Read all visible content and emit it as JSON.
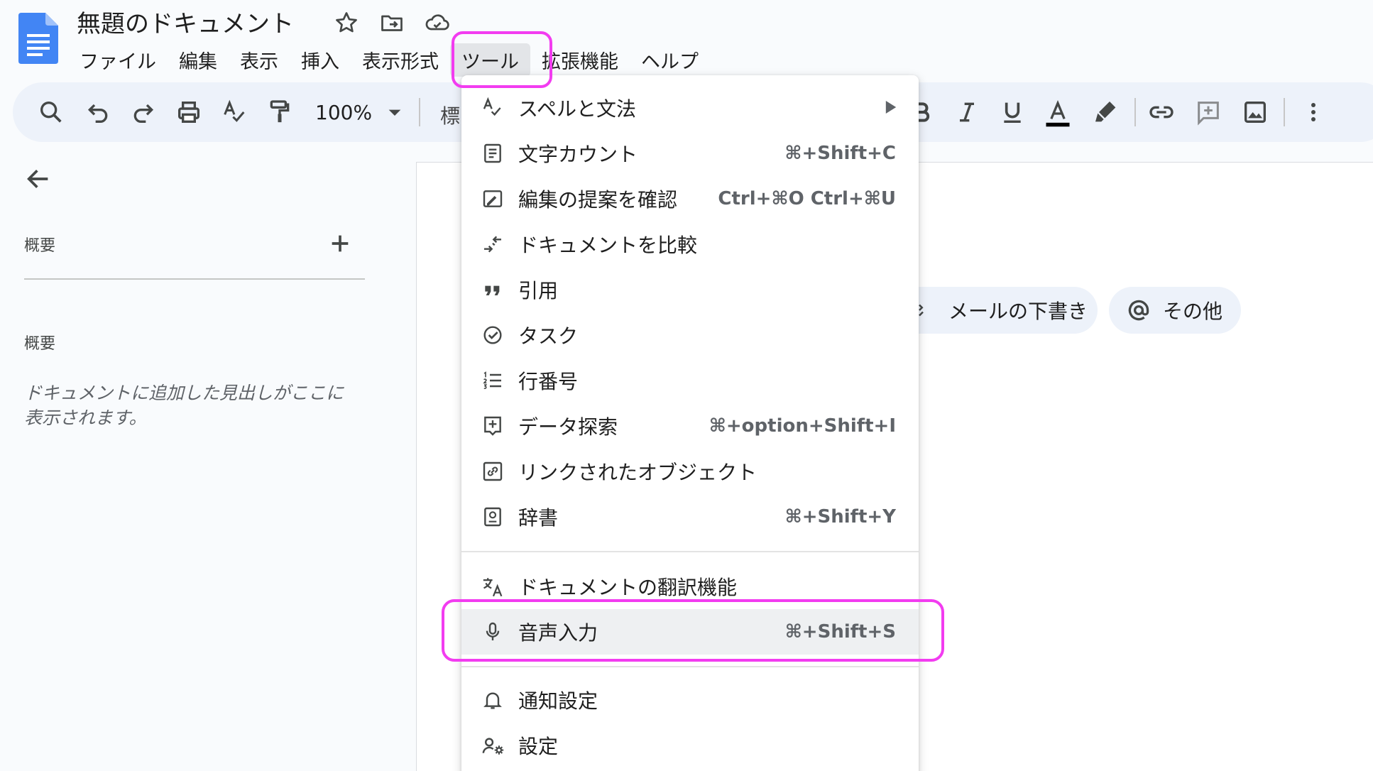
{
  "doc": {
    "title": "無題のドキュメント"
  },
  "menubar": {
    "items": [
      "ファイル",
      "編集",
      "表示",
      "挿入",
      "表示形式",
      "ツール",
      "拡張機能",
      "ヘルプ"
    ],
    "active": "ツール"
  },
  "toolbar": {
    "zoom": "100%",
    "style_label": "標"
  },
  "outline": {
    "header": "概要",
    "sub": "概要",
    "hint": "ドキュメントに追加した見出しがここに表示されます。"
  },
  "chips": [
    {
      "label": "メールの下書き",
      "icon": "email-draft-icon"
    },
    {
      "label": "その他",
      "icon": "at-sign-icon"
    }
  ],
  "tools_menu": {
    "items": [
      {
        "label": "スペルと文法",
        "shortcut": "",
        "submenu": true,
        "icon": "spellcheck-icon"
      },
      {
        "label": "文字カウント",
        "shortcut": "⌘+Shift+C",
        "icon": "word-count-icon"
      },
      {
        "label": "編集の提案を確認",
        "shortcut": "Ctrl+⌘O Ctrl+⌘U",
        "icon": "review-edits-icon"
      },
      {
        "label": "ドキュメントを比較",
        "shortcut": "",
        "icon": "compare-icon"
      },
      {
        "label": "引用",
        "shortcut": "",
        "icon": "quote-icon"
      },
      {
        "label": "タスク",
        "shortcut": "",
        "icon": "task-check-icon"
      },
      {
        "label": "行番号",
        "shortcut": "",
        "icon": "line-numbers-icon"
      },
      {
        "label": "データ探索",
        "shortcut": "⌘+option+Shift+I",
        "icon": "explore-icon"
      },
      {
        "label": "リンクされたオブジェクト",
        "shortcut": "",
        "icon": "linked-object-icon"
      },
      {
        "label": "辞書",
        "shortcut": "⌘+Shift+Y",
        "icon": "dictionary-icon"
      },
      {
        "label": "ドキュメントの翻訳機能",
        "shortcut": "",
        "icon": "translate-icon"
      },
      {
        "label": "音声入力",
        "shortcut": "⌘+Shift+S",
        "icon": "microphone-icon"
      },
      {
        "label": "通知設定",
        "shortcut": "",
        "icon": "bell-icon"
      },
      {
        "label": "設定",
        "shortcut": "",
        "icon": "preferences-icon"
      }
    ]
  },
  "colors": {
    "highlight": "#f23cf0",
    "brand_blue": "#4285f4",
    "toolbar_bg": "#edf2fa"
  }
}
